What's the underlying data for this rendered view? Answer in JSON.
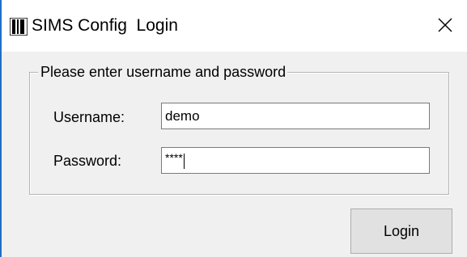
{
  "window": {
    "title": "SIMS Config  Login",
    "close_glyph": "✕"
  },
  "icons": {
    "app": "app-logo-icon",
    "close": "close-icon"
  },
  "group": {
    "legend": "Please enter username and password"
  },
  "form": {
    "username_label": "Username:",
    "username_value": "demo",
    "password_label": "Password:",
    "password_masked": "****"
  },
  "buttons": {
    "login_label": "Login"
  },
  "colors": {
    "accent_border": "#1f6fc6",
    "dialog_bg": "#f0f0f0",
    "titlebar_bg": "#ffffff"
  }
}
